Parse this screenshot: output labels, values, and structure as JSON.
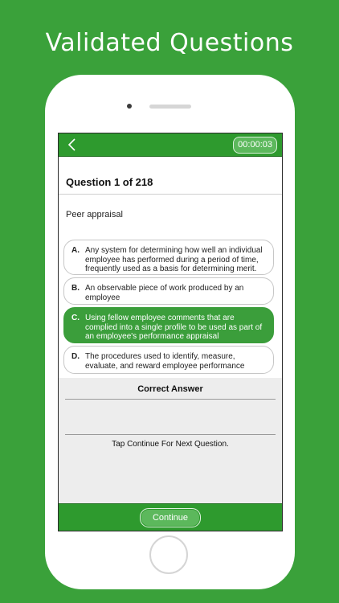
{
  "promo": {
    "title": "Validated Questions"
  },
  "topbar": {
    "timer": "00:00:03"
  },
  "question": {
    "header": "Question 1 of 218",
    "text": "Peer appraisal",
    "options": [
      {
        "letter": "A.",
        "text": "Any system for determining how well an individual employee has performed during a period of time, frequently used as a basis for determining merit.",
        "selected": false
      },
      {
        "letter": "B.",
        "text": "An observable piece of work produced by an employee",
        "selected": false
      },
      {
        "letter": "C.",
        "text": "Using fellow employee comments that are complied into a single profile to be used as part of an employee's performance appraisal",
        "selected": true
      },
      {
        "letter": "D.",
        "text": "The procedures used to identify, measure, evaluate, and reward employee performance",
        "selected": false
      }
    ]
  },
  "answer": {
    "label": "Correct Answer",
    "instruction": "Tap Continue For Next Question."
  },
  "bottombar": {
    "continue_label": "Continue"
  },
  "colors": {
    "brand_green": "#3aa13a",
    "bar_green": "#2e9a2e",
    "selected_green": "#3b9e3b"
  }
}
